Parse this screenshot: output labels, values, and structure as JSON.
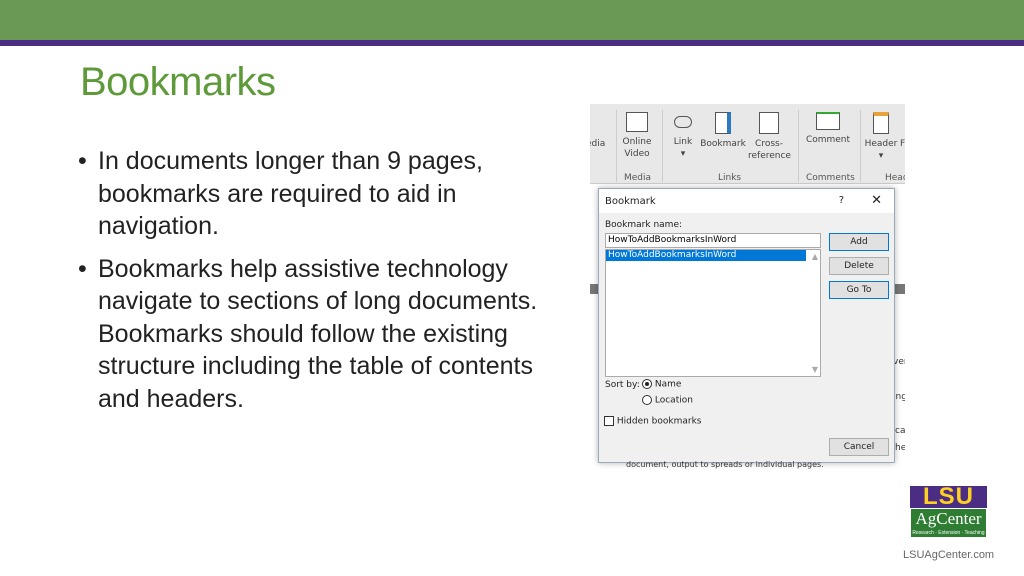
{
  "slide": {
    "title": "Bookmarks",
    "bullets": [
      "In documents longer than 9 pages, bookmarks are required to aid in navigation.",
      "Bookmarks help assistive technology navigate to sections of long documents. Bookmarks should follow the existing structure including the table of contents and headers."
    ]
  },
  "ribbon": {
    "buttons": [
      "edia",
      "Online Video",
      "Link",
      "Bookmark",
      "Cross-reference",
      "Comment",
      "Header",
      "F"
    ],
    "groups": [
      "Media",
      "Links",
      "Comments",
      "Head"
    ]
  },
  "dialog": {
    "title": "Bookmark",
    "help": "?",
    "close": "✕",
    "name_label": "Bookmark name:",
    "name_value": "HowToAddBookmarksInWord",
    "list_items": [
      "HowToAddBookmarksInWord"
    ],
    "add": "Add",
    "delete": "Delete",
    "goto": "Go To",
    "sort_by": "Sort by:",
    "sort_options": [
      "Name",
      "Location"
    ],
    "sort_selected": "Name",
    "hidden": "Hidden bookmarks",
    "cancel": "Cancel"
  },
  "background_doc": {
    "fragments": [
      "ver",
      "ing",
      "ca",
      "he"
    ],
    "note": "document, output to spreads or individual pages."
  },
  "branding": {
    "logo_top": "LSU",
    "logo_mid": "AgCenter",
    "logo_tag": "Research · Extension · Teaching",
    "url": "LSUAgCenter.com"
  },
  "colors": {
    "top_bar": "#6a9955",
    "accent_purple": "#4b2e83",
    "title_green": "#5e9a3a"
  }
}
